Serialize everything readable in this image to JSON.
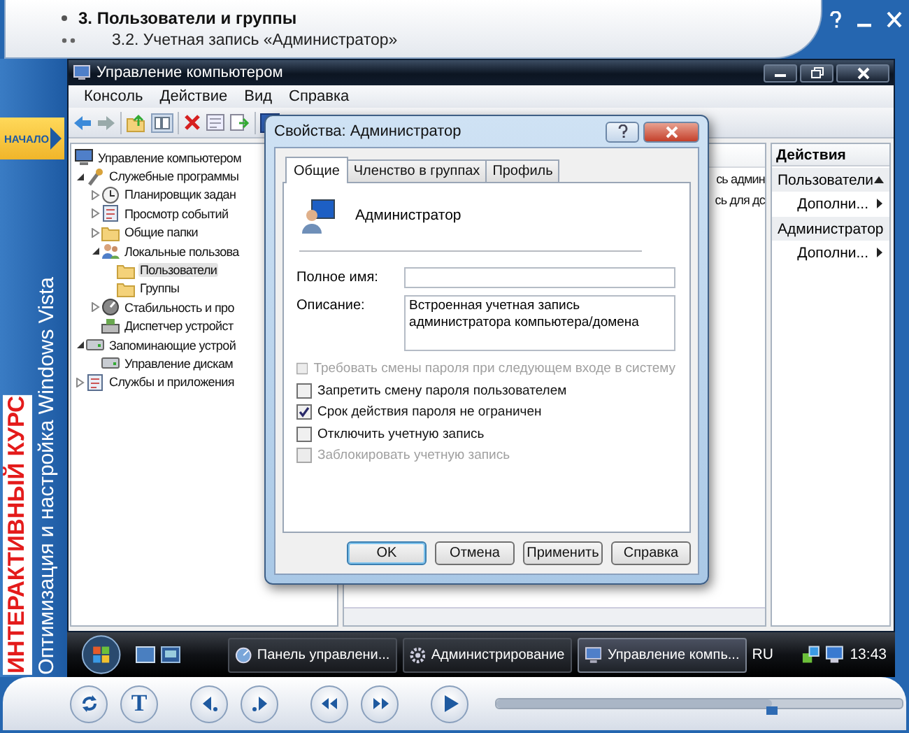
{
  "course_header": {
    "chapter": "3. Пользователи и группы",
    "section": "3.2. Учетная запись «Администратор»"
  },
  "side_strip": {
    "start_button": "НАЧАЛО",
    "course_title": "ИНТЕРАКТИВНЫЙ КУРС",
    "course_subtitle": "Оптимизация и настройка Windows Vista"
  },
  "window": {
    "title": "Управление компьютером"
  },
  "menu": [
    "Консоль",
    "Действие",
    "Вид",
    "Справка"
  ],
  "tree": [
    {
      "label": "Управление компьютером",
      "kind": "computer",
      "selected": false,
      "children": [
        {
          "label": "Служебные программы",
          "kind": "tools",
          "expanded": true,
          "selected": false,
          "children": [
            {
              "label": "Планировщик задан",
              "kind": "clock",
              "expanded": false,
              "selected": false
            },
            {
              "label": "Просмотр событий",
              "kind": "page",
              "expanded": false,
              "selected": false
            },
            {
              "label": "Общие папки",
              "kind": "folder",
              "expanded": false,
              "selected": false
            },
            {
              "label": "Локальные пользова",
              "kind": "users",
              "expanded": true,
              "selected": false,
              "children": [
                {
                  "label": "Пользователи",
                  "kind": "folder",
                  "selected": true
                },
                {
                  "label": "Группы",
                  "kind": "folder",
                  "selected": false
                }
              ]
            },
            {
              "label": "Стабильность и про",
              "kind": "gauge",
              "expanded": false,
              "selected": false
            },
            {
              "label": "Диспетчер устройст",
              "kind": "device",
              "selected": false
            }
          ]
        },
        {
          "label": "Запоминающие устрой",
          "kind": "disk",
          "expanded": true,
          "selected": false,
          "children": [
            {
              "label": "Управление дискам",
              "kind": "disk",
              "selected": false
            }
          ]
        },
        {
          "label": "Службы и приложения",
          "kind": "page",
          "expanded": false,
          "selected": false
        }
      ]
    }
  ],
  "list_fragments": [
    "сь админ",
    "сь для дс"
  ],
  "actions": {
    "title": "Действия",
    "groups": [
      {
        "label": "Пользователи",
        "items": [
          "Дополни..."
        ]
      },
      {
        "label": "Администратор",
        "items": [
          "Дополни..."
        ]
      }
    ]
  },
  "dialog": {
    "title": "Свойства: Администратор",
    "tabs": [
      {
        "label": "Общие",
        "selected": true
      },
      {
        "label": "Членство в группах",
        "selected": false
      },
      {
        "label": "Профиль",
        "selected": false
      }
    ],
    "user_name": "Администратор",
    "fields": [
      {
        "label": "Полное имя:",
        "kind": "line"
      },
      {
        "label": "Описание:",
        "value": "Встроенная учетная запись администратора компьютера/домена",
        "kind": "box"
      }
    ],
    "options": [
      {
        "label": "Требовать смены пароля при следующем входе в систему",
        "checked": false,
        "disabled": true
      },
      {
        "label": "Запретить смену пароля пользователем",
        "checked": false,
        "disabled": false
      },
      {
        "label": "Срок действия пароля не ограничен",
        "checked": true,
        "disabled": false
      },
      {
        "label": "Отключить учетную запись",
        "checked": false,
        "disabled": false
      },
      {
        "label": "Заблокировать учетную запись",
        "checked": false,
        "disabled": true
      }
    ],
    "buttons": [
      {
        "label": "OK",
        "default": true
      },
      {
        "label": "Отмена",
        "default": false
      },
      {
        "label": "Применить",
        "default": false
      },
      {
        "label": "Справка",
        "default": false
      }
    ]
  },
  "taskbar": {
    "tasks": [
      {
        "label": "Панель управлени...",
        "selected": false
      },
      {
        "label": "Администрирование",
        "selected": false
      },
      {
        "label": "Управление компь...",
        "selected": true
      }
    ],
    "language": "RU",
    "clock": "13:43"
  },
  "player": {
    "text_button": "T",
    "level": 0.68
  }
}
